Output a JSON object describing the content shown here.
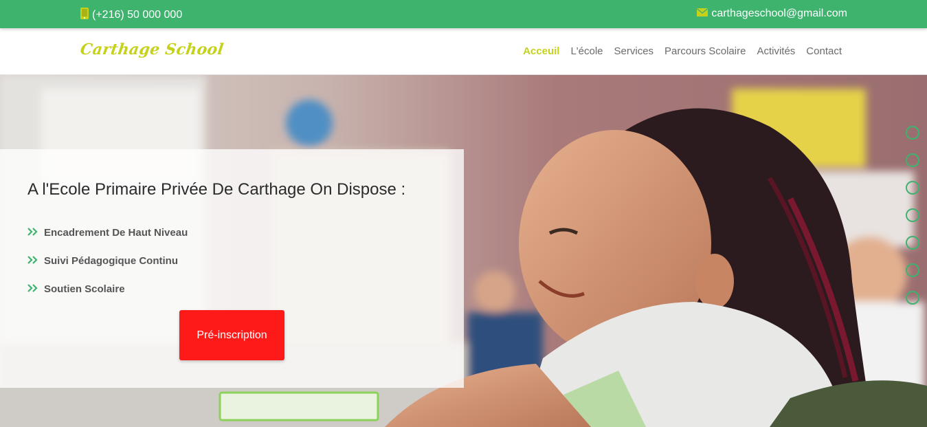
{
  "topbar": {
    "phone": "(+216) 50 000 000",
    "email": "carthageschool@gmail.com",
    "phone_icon": "phone-icon",
    "email_icon": "envelope-icon",
    "background_color": "#3db36e",
    "icon_color": "#c6d11c"
  },
  "header": {
    "logo": "Carthage School",
    "logo_color": "#c6d11c",
    "nav": [
      {
        "label": "Acceuil",
        "active": true
      },
      {
        "label": "L'école",
        "active": false
      },
      {
        "label": "Services",
        "active": false
      },
      {
        "label": "Parcours Scolaire",
        "active": false
      },
      {
        "label": "Activités",
        "active": false
      },
      {
        "label": "Contact",
        "active": false
      }
    ]
  },
  "hero": {
    "title": "A l'Ecole Primaire Privée De Carthage On Dispose :",
    "features": [
      "Encadrement De Haut Niveau",
      "Suivi Pédagogique Continu",
      "Soutien Scolaire"
    ],
    "feature_icon": "double-chevron-right-icon",
    "cta_label": "Pré-inscription",
    "cta_color": "#ff1a1a",
    "slider_dots": 7
  }
}
